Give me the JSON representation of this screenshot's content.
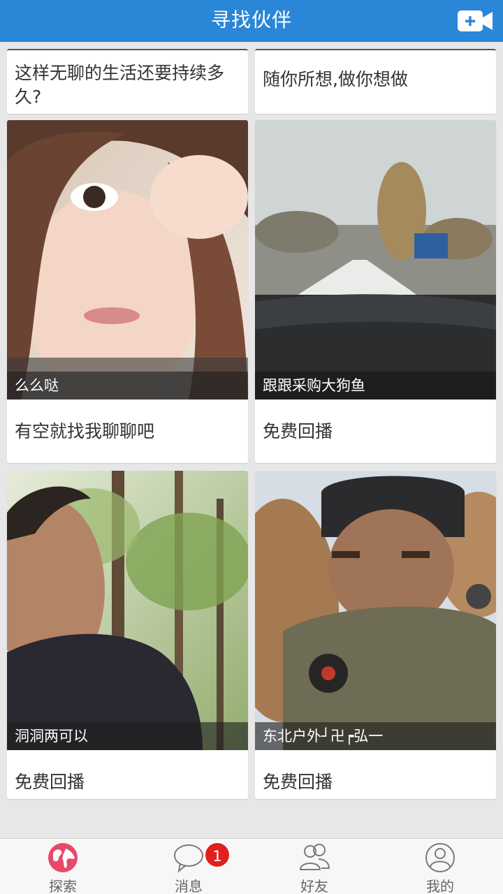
{
  "header": {
    "title": "寻找伙伴"
  },
  "feed": {
    "top_cards": [
      {
        "text": "这样无聊的生活还要持续多久?"
      },
      {
        "text": "随你所想,做你想做"
      }
    ],
    "cards": [
      {
        "caption": "么么哒",
        "desc": "有空就找我聊聊吧"
      },
      {
        "caption": "跟跟采购大狗鱼",
        "desc": "免费回播"
      },
      {
        "caption": "洞洞两可以",
        "desc": "免费回播"
      },
      {
        "caption": "东北户外┘卍┍弘一",
        "desc": "免费回播"
      }
    ]
  },
  "nav": {
    "items": [
      {
        "label": "探索",
        "icon": "globe-icon"
      },
      {
        "label": "消息",
        "icon": "chat-bubble-icon",
        "badge": "1"
      },
      {
        "label": "好友",
        "icon": "friends-icon"
      },
      {
        "label": "我的",
        "icon": "user-icon"
      }
    ]
  },
  "colors": {
    "header_bg": "#2a86d6",
    "badge": "#e0201d",
    "explore_active": "#e8496a"
  }
}
